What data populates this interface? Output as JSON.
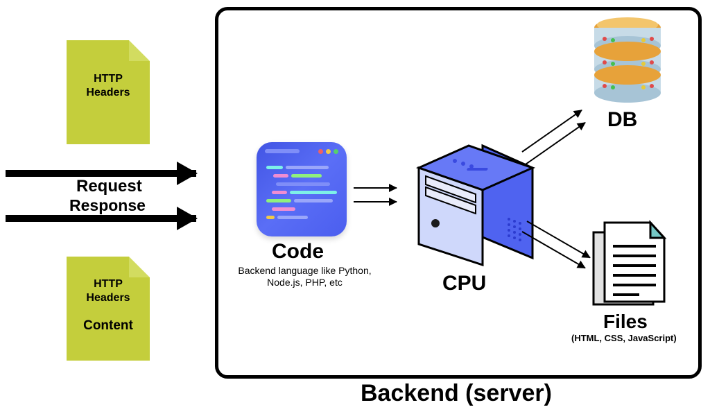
{
  "diagram": {
    "title": "Backend (server)",
    "left": {
      "request_doc": {
        "line1": "HTTP",
        "line2": "Headers"
      },
      "response_doc": {
        "line1": "HTTP",
        "line2": "Headers",
        "content": "Content"
      },
      "request_label": "Request",
      "response_label": "Response"
    },
    "nodes": {
      "code": {
        "label": "Code",
        "sub": "Backend language like Python, Node.js, PHP, etc"
      },
      "cpu": {
        "label": "CPU"
      },
      "db": {
        "label": "DB"
      },
      "files": {
        "label": "Files",
        "sub": "(HTML, CSS, JavaScript)"
      }
    }
  }
}
